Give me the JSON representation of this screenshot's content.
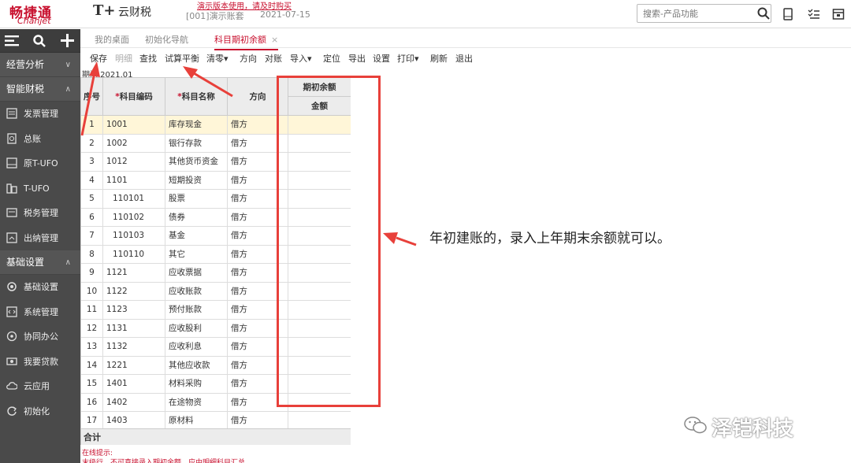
{
  "header": {
    "logo_main": "畅捷通",
    "logo_sub": "Chanjet",
    "product_mark": "T+",
    "product_name": "云财税",
    "demo_notice": "演示版本使用，请及时购买",
    "account": "[001]演示账套",
    "date": "2021-07-15",
    "search_placeholder": "搜索-产品功能"
  },
  "sidebar": {
    "sections": [
      {
        "label": "经营分析",
        "chev": "∨"
      },
      {
        "label": "智能财税",
        "chev": "∧"
      },
      {
        "label": "基础设置",
        "chev": "∧"
      }
    ],
    "items_finance": [
      "发票管理",
      "总账",
      "原T-UFO",
      "T-UFO",
      "税务管理",
      "出纳管理"
    ],
    "items_basic": [
      "基础设置",
      "系统管理",
      "协同办公",
      "我要贷款",
      "云应用",
      "初始化"
    ]
  },
  "tabs": [
    {
      "label": "我的桌面"
    },
    {
      "label": "初始化导航"
    },
    {
      "label": "科目期初余额"
    }
  ],
  "tab_close": "×",
  "toolbar": [
    "保存",
    "明细",
    "查找",
    "试算平衡",
    "清零▾",
    "方向",
    "对账",
    "导入▾",
    "定位",
    "导出",
    "设置",
    "打印▾",
    "刷新",
    "退出"
  ],
  "period_label": "期间 2021.01",
  "grid": {
    "headers": {
      "seq": "序号",
      "code": "科目编码",
      "name": "科目名称",
      "direction": "方向",
      "opening": "期初余额",
      "amount": "金额",
      "required": "*"
    },
    "rows": [
      {
        "seq": "1",
        "code": "1001",
        "name": "库存现金",
        "dir": "借方"
      },
      {
        "seq": "2",
        "code": "1002",
        "name": "银行存款",
        "dir": "借方"
      },
      {
        "seq": "3",
        "code": "1012",
        "name": "其他货币资金",
        "dir": "借方"
      },
      {
        "seq": "4",
        "code": "1101",
        "name": "短期投资",
        "dir": "借方"
      },
      {
        "seq": "5",
        "code": "110101",
        "name": "股票",
        "dir": "借方"
      },
      {
        "seq": "6",
        "code": "110102",
        "name": "债券",
        "dir": "借方"
      },
      {
        "seq": "7",
        "code": "110103",
        "name": "基金",
        "dir": "借方"
      },
      {
        "seq": "8",
        "code": "110110",
        "name": "其它",
        "dir": "借方"
      },
      {
        "seq": "9",
        "code": "1121",
        "name": "应收票据",
        "dir": "借方"
      },
      {
        "seq": "10",
        "code": "1122",
        "name": "应收账款",
        "dir": "借方"
      },
      {
        "seq": "11",
        "code": "1123",
        "name": "预付账款",
        "dir": "借方"
      },
      {
        "seq": "12",
        "code": "1131",
        "name": "应收股利",
        "dir": "借方"
      },
      {
        "seq": "13",
        "code": "1132",
        "name": "应收利息",
        "dir": "借方"
      },
      {
        "seq": "14",
        "code": "1221",
        "name": "其他应收款",
        "dir": "借方"
      },
      {
        "seq": "15",
        "code": "1401",
        "name": "材料采购",
        "dir": "借方"
      },
      {
        "seq": "16",
        "code": "1402",
        "name": "在途物资",
        "dir": "借方"
      },
      {
        "seq": "17",
        "code": "1403",
        "name": "原材料",
        "dir": "借方"
      }
    ],
    "total_label": "合计"
  },
  "annotation": "年初建账的，录入上年期末余额就可以。",
  "footer": {
    "hint_title": "在线提示:",
    "hint_text": "末级行，不可直接录入期初余额，应由明细科目汇总"
  },
  "watermark": "泽铠科技",
  "colors": {
    "brand_red": "#c8102e",
    "annotation_red": "#e8403a",
    "sidebar": "#4a4a4a",
    "selected_row": "#fff6d8"
  }
}
